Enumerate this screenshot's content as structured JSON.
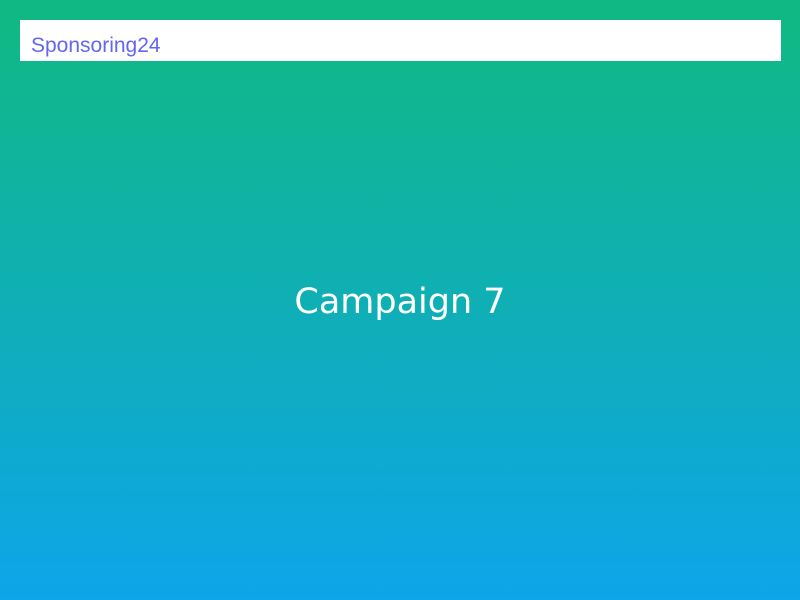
{
  "header": {
    "brand_name": "Sponsoring24"
  },
  "main": {
    "campaign_title": "Campaign 7"
  },
  "colors": {
    "gradient_top": "#10b981",
    "gradient_bottom": "#0ea5e9",
    "brand_text": "#6366f1",
    "header_background": "#ffffff",
    "title_text": "#ffffff"
  }
}
